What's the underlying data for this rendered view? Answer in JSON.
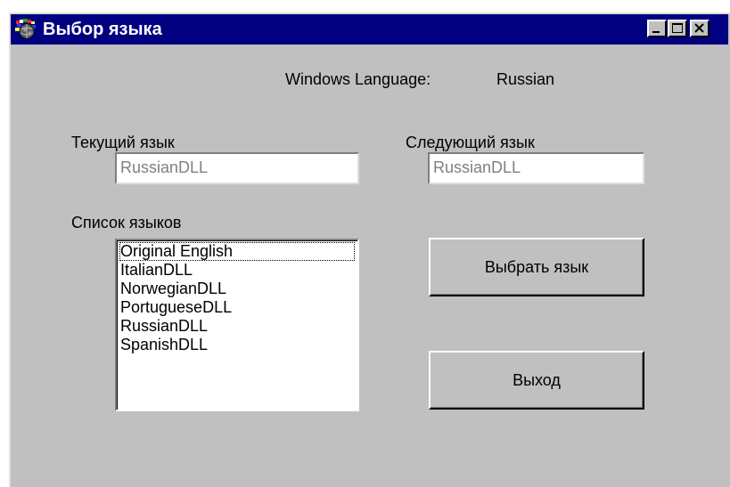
{
  "window": {
    "title": "Выбор языка",
    "icon": "flag-globe-icon",
    "controls": [
      "minimize-icon",
      "maximize-icon",
      "close-icon"
    ]
  },
  "windows_language": {
    "label": "Windows Language:",
    "value": "Russian"
  },
  "current_language": {
    "label": "Текущий язык",
    "value": "RussianDLL"
  },
  "next_language": {
    "label": "Следующий язык",
    "value": "RussianDLL"
  },
  "language_list": {
    "label": "Список языков",
    "items": [
      "Original English",
      "ItalianDLL",
      "NorwegianDLL",
      "PortugueseDLL",
      "RussianDLL",
      "SpanishDLL"
    ],
    "focused_index": 0
  },
  "buttons": {
    "select": "Выбрать язык",
    "exit": "Выход"
  },
  "colors": {
    "titlebar": "#000080",
    "face": "#c0c0c0",
    "disabled_text": "#808080"
  }
}
